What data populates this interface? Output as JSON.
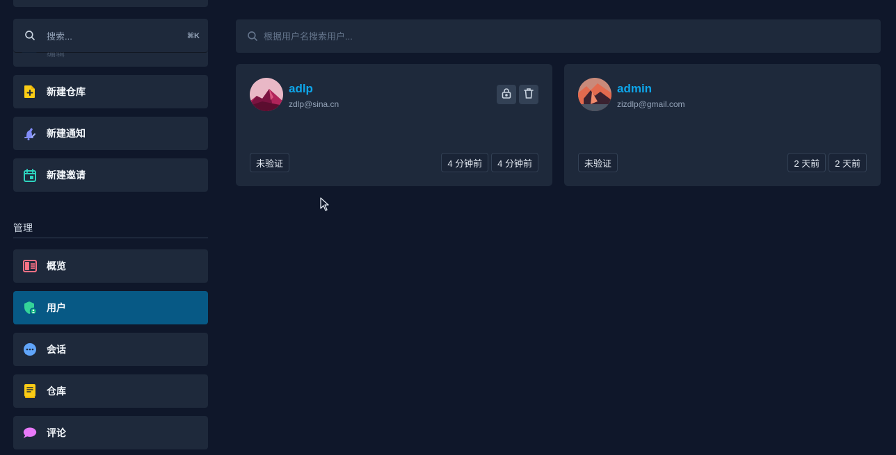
{
  "sidebar": {
    "search": {
      "placeholder": "搜索...",
      "shortcut": "⌘K"
    },
    "hidden_label": "编辑",
    "actions": [
      {
        "label": "新建仓库",
        "icon": "file-plus-icon",
        "color": "#facc15"
      },
      {
        "label": "新建通知",
        "icon": "bell-edit-icon",
        "color": "#818cf8"
      },
      {
        "label": "新建邀请",
        "icon": "calendar-icon",
        "color": "#2dd4bf"
      }
    ],
    "section_title": "管理",
    "admin_items": [
      {
        "label": "概览",
        "icon": "layout-icon",
        "color": "#fb7185"
      },
      {
        "label": "用户",
        "icon": "shield-user-icon",
        "color": "#34d399",
        "active": true
      },
      {
        "label": "会话",
        "icon": "chat-bubble-icon",
        "color": "#60a5fa"
      },
      {
        "label": "仓库",
        "icon": "book-icon",
        "color": "#facc15"
      },
      {
        "label": "评论",
        "icon": "comment-icon",
        "color": "#e879f9"
      }
    ]
  },
  "main": {
    "search_placeholder": "根据用户名搜索用户...",
    "users": [
      {
        "name": "adlp",
        "email": "zdlp@sina.cn",
        "status": "未验证",
        "created": "4 分钟前",
        "updated": "4 分钟前",
        "has_actions": true
      },
      {
        "name": "admin",
        "email": "zizdlp@gmail.com",
        "status": "未验证",
        "created": "2 天前",
        "updated": "2 天前",
        "has_actions": false
      }
    ]
  },
  "colors": {
    "background": "#0f172a",
    "surface": "#1e293b",
    "active": "#075985",
    "accent": "#0ea5e9"
  }
}
